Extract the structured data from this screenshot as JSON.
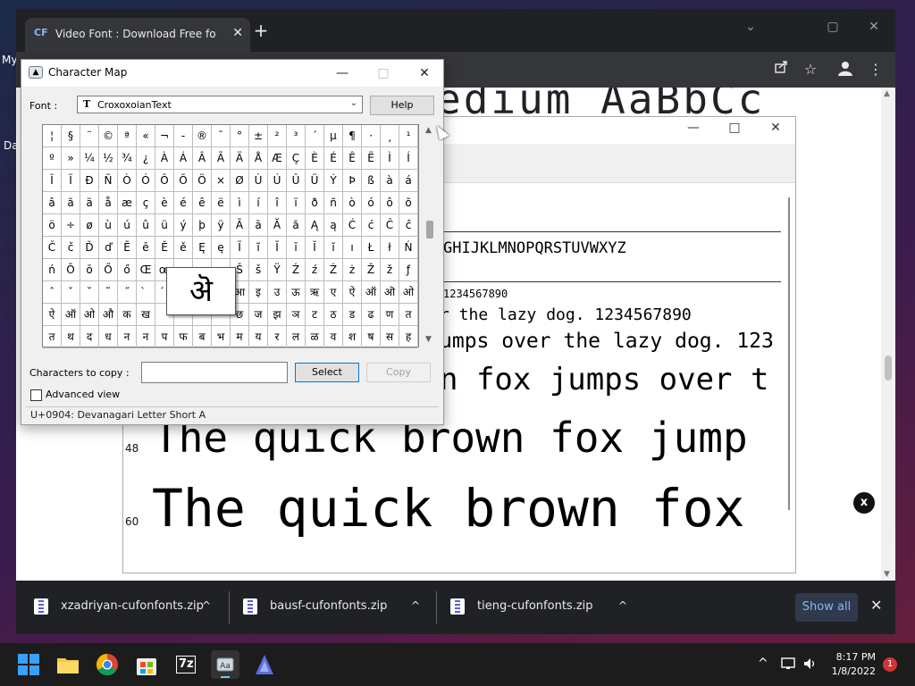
{
  "desktop": {
    "frag_my": "My",
    "frag_da": "Da"
  },
  "browser": {
    "tab": {
      "favicon": "CF",
      "title": "Video Font : Download Free for D",
      "close": "✕"
    },
    "new_tab": "+",
    "window_controls": {
      "minimize": "⌄",
      "maximize": "▢",
      "close": "✕"
    },
    "toolbar_icons": {
      "share": "share-icon",
      "star": "☆",
      "profile": "profile-icon",
      "menu": "⋮"
    },
    "hero_text": "edium AaBbCc",
    "downloads": [
      {
        "name": "xzadriyan-cufonfonts.zip",
        "caret": "^"
      },
      {
        "name": "bausf-cufonfonts.zip",
        "caret": "^"
      },
      {
        "name": "tieng-cufonfonts.zip",
        "caret": "^"
      }
    ],
    "show_all": "Show all",
    "close_downloads": "✕"
  },
  "preview": {
    "controls": {
      "minimize": "—",
      "maximize": "□",
      "close": "✕"
    },
    "alphabet": "GHIJKLMNOPQRSTUVWXYZ",
    "lines": [
      {
        "text": "1234567890"
      },
      {
        "text": "r the lazy dog. 1234567890"
      },
      {
        "text": "umps over the lazy dog. 123"
      },
      {
        "text": "n fox jumps over t"
      },
      {
        "size": "48",
        "text": "The quick brown fox jump"
      },
      {
        "size": "60",
        "text": "The quick brown fox"
      }
    ],
    "close_badge": "x"
  },
  "charmap": {
    "title": "Character Map",
    "window_controls": {
      "minimize": "—",
      "maximize": "□",
      "close": "✕"
    },
    "font_label": "Font :",
    "font_value": "CroxoxoianText",
    "font_type_glyph": "T",
    "help_button": "Help",
    "grid_rows": [
      [
        "¦",
        "§",
        "¨",
        "©",
        "ª",
        "«",
        "¬",
        "-",
        "®",
        "¯",
        "°",
        "±",
        "²",
        "³",
        "´",
        "µ",
        "¶",
        "·",
        "¸",
        "¹"
      ],
      [
        "º",
        "»",
        "¼",
        "½",
        "¾",
        "¿",
        "À",
        "Á",
        "Â",
        "Ã",
        "Ä",
        "Å",
        "Æ",
        "Ç",
        "È",
        "É",
        "Ê",
        "Ë",
        "Ì",
        "Í"
      ],
      [
        "Î",
        "Ï",
        "Ð",
        "Ñ",
        "Ò",
        "Ó",
        "Ô",
        "Õ",
        "Ö",
        "×",
        "Ø",
        "Ù",
        "Ú",
        "Û",
        "Ü",
        "Ý",
        "Þ",
        "ß",
        "à",
        "á"
      ],
      [
        "â",
        "ã",
        "ä",
        "å",
        "æ",
        "ç",
        "è",
        "é",
        "ê",
        "ë",
        "ì",
        "í",
        "î",
        "ï",
        "ð",
        "ñ",
        "ò",
        "ó",
        "ô",
        "õ"
      ],
      [
        "ö",
        "÷",
        "ø",
        "ù",
        "ú",
        "û",
        "ü",
        "ý",
        "þ",
        "ÿ",
        "Ā",
        "ā",
        "Ă",
        "ă",
        "Ą",
        "ą",
        "Ć",
        "ć",
        "Ĉ",
        "ĉ"
      ],
      [
        "Č",
        "č",
        "Ď",
        "ď",
        "Ē",
        "ē",
        "Ě",
        "ě",
        "Ę",
        "ę",
        "Ĩ",
        "ĩ",
        "Ī",
        "ī",
        "Ĭ",
        "ĭ",
        "ı",
        "Ł",
        "ł",
        "Ń"
      ],
      [
        "ń",
        "Ō",
        "ō",
        "Ő",
        "ő",
        "Œ",
        "œ",
        "",
        "",
        "",
        "Š",
        "š",
        "Ÿ",
        "Ź",
        "ź",
        "Ż",
        "ż",
        "Ž",
        "ž",
        "ƒ"
      ],
      [
        "ˆ",
        "ˇ",
        "˘",
        "˜",
        "˝",
        "̀",
        "́",
        "",
        "",
        "",
        "आ",
        "इ",
        "उ",
        "ऊ",
        "ऋ",
        "ए",
        "ऐ",
        "ऑ",
        "ऒ",
        "ओ"
      ],
      [
        "ऐ",
        "ऑ",
        "ओ",
        "औ",
        "क",
        "ख",
        "",
        "",
        "",
        "",
        "छ",
        "ज",
        "झ",
        "ञ",
        "ट",
        "ठ",
        "ड",
        "ढ",
        "ण",
        "त"
      ],
      [
        "त",
        "थ",
        "द",
        "ध",
        "न",
        "न",
        "प",
        "फ",
        "ब",
        "भ",
        "म",
        "य",
        "र",
        "ल",
        "ळ",
        "व",
        "श",
        "ष",
        "स",
        "ह"
      ]
    ],
    "zoom_char": "ऄ",
    "chars_to_copy_label": "Characters to copy :",
    "chars_to_copy_value": "",
    "select_button": "Select",
    "copy_button": "Copy",
    "advanced_view_label": "Advanced view",
    "status": "U+0904: Devanagari Letter Short A"
  },
  "taskbar": {
    "apps": [
      "start-icon",
      "file-explorer-icon",
      "chrome-icon",
      "store-icon",
      "7zip-icon",
      "character-map-icon",
      "font-app-icon"
    ],
    "sevenzip_label": "7z",
    "tray": {
      "chevron": "^",
      "time": "8:17 PM",
      "date": "1/8/2022",
      "notifications": "1"
    }
  }
}
